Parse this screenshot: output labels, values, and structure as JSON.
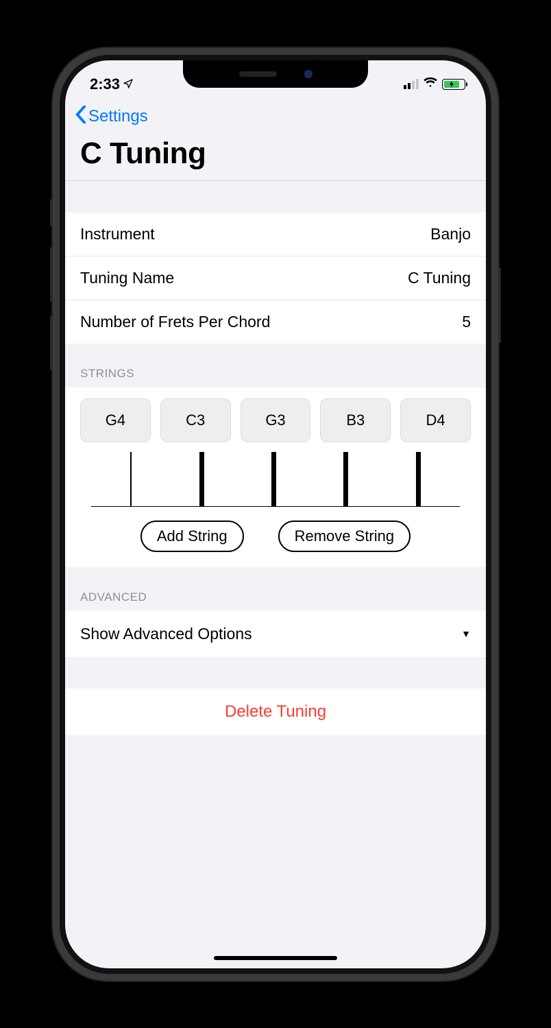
{
  "status": {
    "time": "2:33"
  },
  "nav": {
    "back": "Settings"
  },
  "title": "C Tuning",
  "rows": {
    "instrument_label": "Instrument",
    "instrument_value": "Banjo",
    "tuning_name_label": "Tuning Name",
    "tuning_name_value": "C Tuning",
    "frets_label": "Number of Frets Per Chord",
    "frets_value": "5"
  },
  "sections": {
    "strings": "STRINGS",
    "advanced": "ADVANCED"
  },
  "strings": [
    "G4",
    "C3",
    "G3",
    "B3",
    "D4"
  ],
  "buttons": {
    "add_string": "Add String",
    "remove_string": "Remove String",
    "advanced": "Show Advanced Options",
    "delete": "Delete Tuning"
  }
}
